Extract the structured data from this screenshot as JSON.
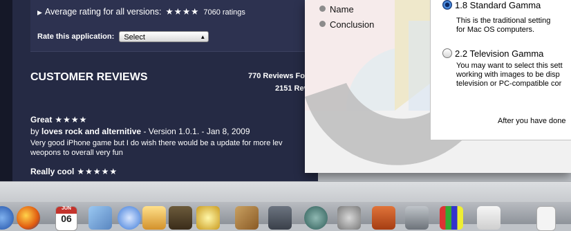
{
  "store": {
    "average_rating_label": "Average rating for all versions:",
    "average_stars": "★★★★",
    "ratings_count": "7060 ratings",
    "rate_label": "Rate this application:",
    "rate_select_value": "Select",
    "customer_reviews_title": "CUSTOMER REVIEWS",
    "reviews_summary_1": "770 Reviews Fo",
    "reviews_summary_2": "2151 Rev",
    "reviews": [
      {
        "title": "Great",
        "stars": "★★★★",
        "by_prefix": "by",
        "author": "loves rock and alternitive",
        "meta": "- Version 1.0.1. - Jan 8, 2009",
        "body_line1": "Very good iPhone game but I do wish there would be a update for more lev",
        "body_line2": "weopons to overall very fun"
      },
      {
        "title": "Really cool",
        "stars": "★★★★★"
      }
    ]
  },
  "dialog": {
    "steps": [
      {
        "label": "Name"
      },
      {
        "label": "Conclusion"
      }
    ],
    "options": [
      {
        "label": "1.8 Standard Gamma",
        "selected": true,
        "desc_line1": "This is the traditional setting",
        "desc_line2": "for Mac OS computers."
      },
      {
        "label": "2.2 Television Gamma",
        "selected": false,
        "desc_line1": "You may want to select this sett",
        "desc_line2": "working with images to be disp",
        "desc_line3": "television or PC-compatible cor"
      }
    ],
    "after_text": "After you have done"
  },
  "dock": {
    "calendar_month": "JUN",
    "calendar_day": "06"
  }
}
